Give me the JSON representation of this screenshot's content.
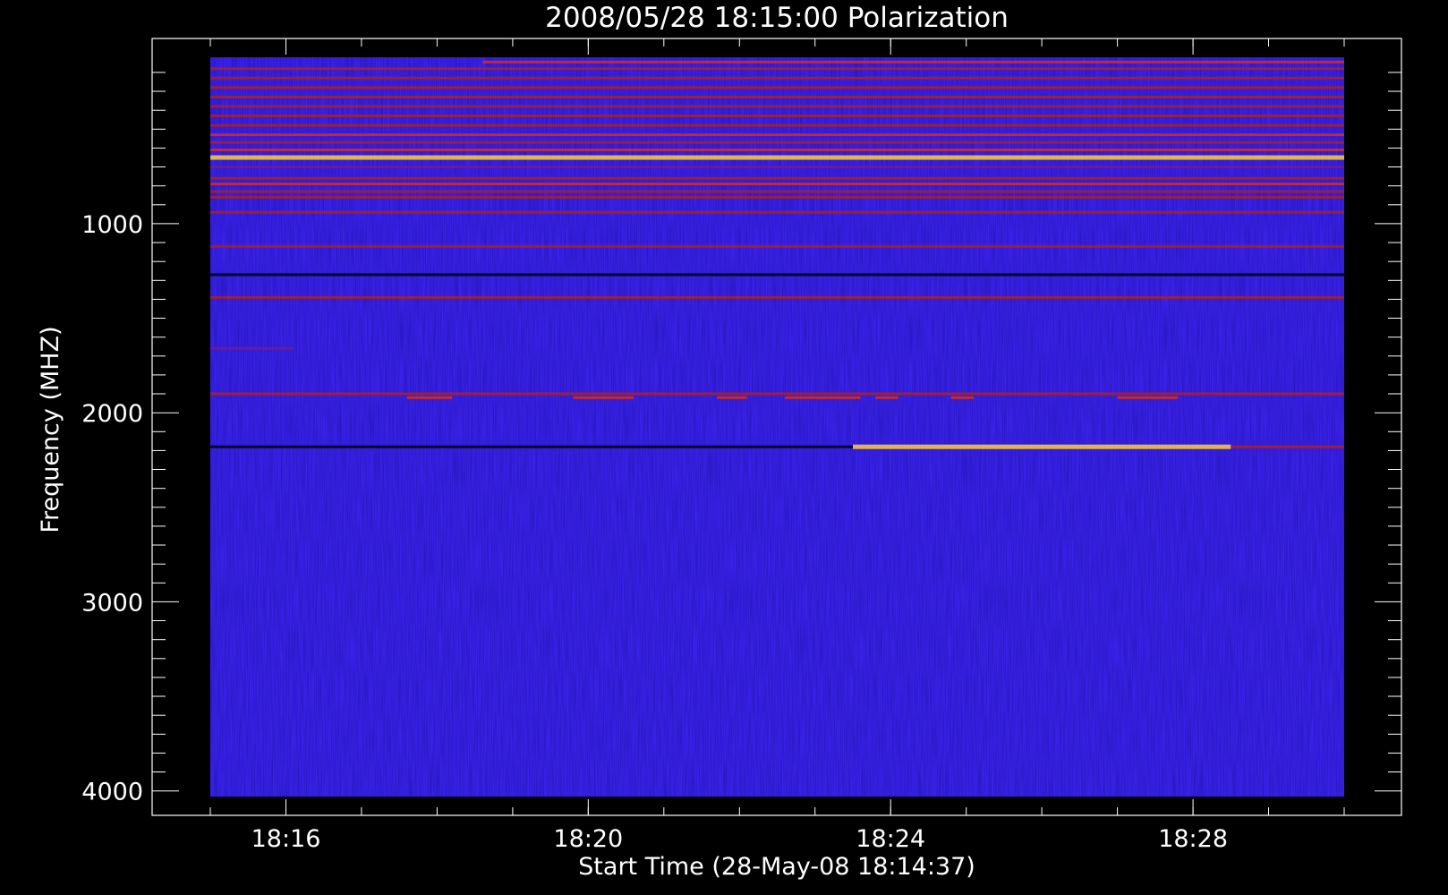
{
  "chart_data": {
    "type": "heatmap",
    "title": "2008/05/28 18:15:00 Polarization",
    "xlabel": "Start Time (28-May-08 18:14:37)",
    "ylabel": "Frequency (MHZ)",
    "x_range": [
      "18:15:00",
      "18:30:00"
    ],
    "y_range_mhz": [
      120,
      4030
    ],
    "y_axis_inverted": true,
    "x_ticks": [
      {
        "label": "18:16",
        "minutes": 16
      },
      {
        "label": "18:20",
        "minutes": 20
      },
      {
        "label": "18:24",
        "minutes": 24
      },
      {
        "label": "18:28",
        "minutes": 28
      }
    ],
    "y_ticks": [
      {
        "label": "1000",
        "value": 1000
      },
      {
        "label": "2000",
        "value": 2000
      },
      {
        "label": "3000",
        "value": 3000
      },
      {
        "label": "4000",
        "value": 4000
      }
    ],
    "colors": {
      "background": "#000000",
      "foreground": "#ffffff",
      "base": "#3a22e8",
      "low": "#000000",
      "mid": "#e02a10",
      "high": "#ffd030",
      "peak": "#ffffff"
    },
    "bands": [
      {
        "freq_mhz": 145,
        "intensity": 0.8,
        "segments": [
          [
            18.6,
            30
          ]
        ]
      },
      {
        "freq_mhz": 180,
        "intensity": 0.6,
        "segments": [
          [
            15,
            30
          ]
        ]
      },
      {
        "freq_mhz": 230,
        "intensity": 0.6,
        "segments": [
          [
            15,
            30
          ]
        ]
      },
      {
        "freq_mhz": 280,
        "intensity": 0.5,
        "segments": [
          [
            15,
            30
          ]
        ]
      },
      {
        "freq_mhz": 330,
        "intensity": 0.7,
        "segments": [
          [
            15,
            30
          ]
        ]
      },
      {
        "freq_mhz": 380,
        "intensity": 0.5,
        "segments": [
          [
            15,
            30
          ]
        ]
      },
      {
        "freq_mhz": 430,
        "intensity": 0.6,
        "segments": [
          [
            15,
            30
          ]
        ]
      },
      {
        "freq_mhz": 480,
        "intensity": 0.6,
        "segments": [
          [
            15,
            30
          ]
        ]
      },
      {
        "freq_mhz": 530,
        "intensity": 0.9,
        "segments": [
          [
            15,
            30
          ]
        ]
      },
      {
        "freq_mhz": 570,
        "intensity": 0.7,
        "segments": [
          [
            15,
            30
          ]
        ]
      },
      {
        "freq_mhz": 610,
        "intensity": 0.9,
        "segments": [
          [
            15,
            30
          ]
        ]
      },
      {
        "freq_mhz": 650,
        "intensity": 1.0,
        "segments": [
          [
            15,
            30
          ]
        ]
      },
      {
        "freq_mhz": 700,
        "intensity": 0.4,
        "segments": [
          [
            15,
            30
          ]
        ]
      },
      {
        "freq_mhz": 760,
        "intensity": 0.7,
        "segments": [
          [
            15,
            30
          ]
        ]
      },
      {
        "freq_mhz": 790,
        "intensity": 0.8,
        "segments": [
          [
            15,
            30
          ]
        ]
      },
      {
        "freq_mhz": 830,
        "intensity": 0.6,
        "segments": [
          [
            15,
            30
          ]
        ]
      },
      {
        "freq_mhz": 860,
        "intensity": 0.5,
        "segments": [
          [
            15,
            30
          ]
        ]
      },
      {
        "freq_mhz": 940,
        "intensity": 0.6,
        "segments": [
          [
            15,
            30
          ]
        ]
      },
      {
        "freq_mhz": 1120,
        "intensity": 0.7,
        "segments": [
          [
            15,
            30
          ]
        ]
      },
      {
        "freq_mhz": 1270,
        "intensity": 0.3,
        "segments": [
          [
            15,
            30
          ]
        ]
      },
      {
        "freq_mhz": 1390,
        "intensity": 0.6,
        "segments": [
          [
            15,
            30
          ]
        ]
      },
      {
        "freq_mhz": 1660,
        "intensity": 0.4,
        "segments": [
          [
            15,
            16.1
          ]
        ]
      },
      {
        "freq_mhz": 1900,
        "intensity": 0.7,
        "segments": [
          [
            15,
            30
          ]
        ]
      },
      {
        "freq_mhz": 1920,
        "intensity": 0.8,
        "segments": [
          [
            17.6,
            18.2
          ],
          [
            19.8,
            20.6
          ],
          [
            21.7,
            22.1
          ],
          [
            22.6,
            23.6
          ],
          [
            23.8,
            24.1
          ],
          [
            24.8,
            25.1
          ],
          [
            27,
            27.8
          ]
        ]
      },
      {
        "freq_mhz": 2180,
        "intensity": 0.3,
        "segments": [
          [
            15,
            23.5
          ]
        ]
      },
      {
        "freq_mhz": 2180,
        "intensity": 1.0,
        "segments": [
          [
            23.5,
            28.5
          ]
        ]
      },
      {
        "freq_mhz": 2180,
        "intensity": 0.6,
        "segments": [
          [
            28.5,
            30
          ]
        ]
      }
    ]
  }
}
